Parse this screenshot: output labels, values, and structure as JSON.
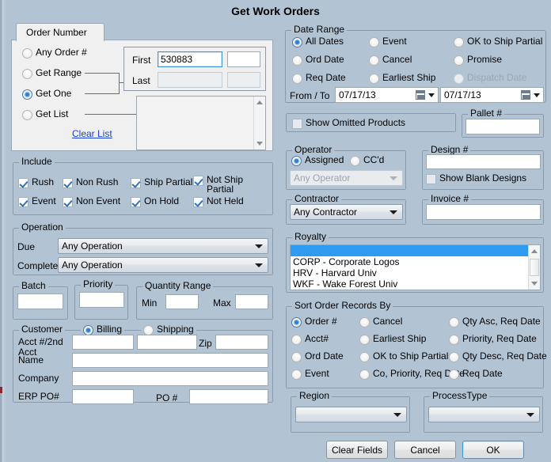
{
  "window": {
    "title": "Get Work Orders",
    "bg_color": "#b2c3d4",
    "accent_color": "#2b7fd4"
  },
  "order_number": {
    "tab_label": "Order Number",
    "radios": [
      {
        "label": "Any Order #",
        "selected": false
      },
      {
        "label": "Get Range",
        "selected": false
      },
      {
        "label": "Get One",
        "selected": true
      },
      {
        "label": "Get List",
        "selected": false
      }
    ],
    "clear_list_link": "Clear List",
    "first_label": "First",
    "last_label": "Last",
    "first_value": "530883",
    "first_value2": "",
    "last_value": "",
    "last_value2": "",
    "list_items": []
  },
  "date_range": {
    "title": "Date Range",
    "radios": [
      {
        "label": "All Dates",
        "selected": true,
        "disabled": false
      },
      {
        "label": "Ord Date",
        "selected": false,
        "disabled": false
      },
      {
        "label": "Req Date",
        "selected": false,
        "disabled": false
      },
      {
        "label": "Event",
        "selected": false,
        "disabled": false
      },
      {
        "label": "Cancel",
        "selected": false,
        "disabled": false
      },
      {
        "label": "Earliest Ship",
        "selected": false,
        "disabled": false
      },
      {
        "label": "OK to Ship Partial",
        "selected": false,
        "disabled": false
      },
      {
        "label": "Promise",
        "selected": false,
        "disabled": false
      },
      {
        "label": "Dispatch Date",
        "selected": false,
        "disabled": true
      }
    ],
    "from_to_label": "From / To",
    "from_value": "07/17/13",
    "to_value": "07/17/13"
  },
  "show_omitted": {
    "label": "Show Omitted Products",
    "checked": false
  },
  "pallet": {
    "title": "Pallet #",
    "value": ""
  },
  "include": {
    "title": "Include",
    "checkboxes": [
      {
        "label": "Rush",
        "checked": true
      },
      {
        "label": "Non Rush",
        "checked": true
      },
      {
        "label": "Ship Partial",
        "checked": true
      },
      {
        "label": "Not Ship Partial",
        "checked": true
      },
      {
        "label": "Event",
        "checked": true
      },
      {
        "label": "Non Event",
        "checked": true
      },
      {
        "label": "On Hold",
        "checked": true
      },
      {
        "label": "Not Held",
        "checked": true
      }
    ]
  },
  "operation": {
    "title": "Operation",
    "due_label": "Due",
    "completed_label": "Completed",
    "due_value": "Any Operation",
    "completed_value": "Any Operation"
  },
  "batch": {
    "title": "Batch",
    "value": ""
  },
  "priority": {
    "title": "Priority",
    "value": ""
  },
  "quantity_range": {
    "title": "Quantity Range",
    "min_label": "Min",
    "max_label": "Max",
    "min_value": "",
    "max_value": ""
  },
  "customer": {
    "title": "Customer",
    "billing_label": "Billing",
    "shipping_label": "Shipping",
    "billing_selected": true,
    "shipping_selected": false,
    "acct_label": "Acct #/2nd Acct",
    "acct_label_line1": "Acct #/2nd",
    "acct_label_line2": "Acct",
    "name_label": "Name",
    "company_label": "Company",
    "erp_po_label": "ERP PO#",
    "po_label": "PO #",
    "zip_label": "Zip",
    "acct_value": "",
    "acct2_value": "",
    "zip_value": "",
    "name_value": "",
    "company_value": "",
    "erp_po_value": "",
    "po_value": ""
  },
  "operator": {
    "title": "Operator",
    "assigned_label": "Assigned",
    "ccd_label": "CC'd",
    "assigned_selected": true,
    "ccd_selected": false,
    "combo_value": "Any Operator",
    "combo_disabled": true
  },
  "design": {
    "title": "Design #",
    "value": "",
    "show_blank_label": "Show Blank Designs",
    "show_blank_checked": false
  },
  "contractor": {
    "title": "Contractor",
    "value": "Any Contractor"
  },
  "invoice": {
    "title": "Invoice #",
    "value": ""
  },
  "royalty": {
    "title": "Royalty",
    "items": [
      {
        "text": "",
        "selected": true
      },
      {
        "text": "CORP - Corporate Logos",
        "selected": false
      },
      {
        "text": "HRV - Harvard Univ",
        "selected": false
      },
      {
        "text": "WKF - Wake Forest Univ",
        "selected": false
      }
    ]
  },
  "sort_order": {
    "title": "Sort Order Records By",
    "radios": [
      {
        "label": "Order #",
        "selected": true
      },
      {
        "label": "Acct#",
        "selected": false
      },
      {
        "label": "Ord Date",
        "selected": false
      },
      {
        "label": "Event",
        "selected": false
      },
      {
        "label": "Cancel",
        "selected": false
      },
      {
        "label": "Earliest Ship",
        "selected": false
      },
      {
        "label": "OK to Ship Partial",
        "selected": false
      },
      {
        "label": "Co, Priority, Req Date",
        "selected": false
      },
      {
        "label": "Qty Asc, Req Date",
        "selected": false
      },
      {
        "label": "Priority, Req Date",
        "selected": false
      },
      {
        "label": "Qty Desc, Req Date",
        "selected": false
      },
      {
        "label": "Req Date",
        "selected": false
      }
    ]
  },
  "region": {
    "title": "Region",
    "value": ""
  },
  "process_type": {
    "title": "ProcessType",
    "value": ""
  },
  "buttons": {
    "clear_fields": "Clear Fields",
    "cancel": "Cancel",
    "ok": "OK"
  }
}
